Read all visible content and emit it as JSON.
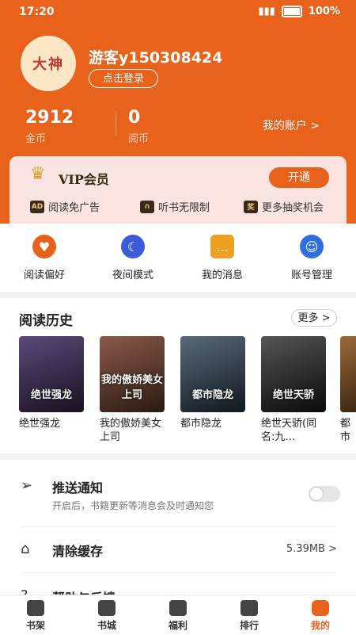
{
  "status": {
    "time": "17:20",
    "battery": "100%"
  },
  "profile": {
    "avatar_text": "大神",
    "username": "游客y150308424",
    "login_label": "点击登录"
  },
  "stats": {
    "coins_value": "2912",
    "coins_label": "金币",
    "read_coins_value": "0",
    "read_coins_label": "阅币",
    "account_link": "我的账户 >"
  },
  "vip": {
    "title": "VIP会员",
    "open_label": "开通",
    "features": [
      {
        "icon": "AD",
        "label": "阅读免广告"
      },
      {
        "icon": "headphones-icon",
        "label": "听书无限制"
      },
      {
        "icon": "奖",
        "label": "更多抽奖机会"
      }
    ]
  },
  "quick_actions": [
    {
      "label": "阅读偏好",
      "icon": "heart-icon",
      "color": "#e8621c"
    },
    {
      "label": "夜间模式",
      "icon": "moon-icon",
      "color": "#3b5bdb"
    },
    {
      "label": "我的消息",
      "icon": "message-icon",
      "color": "#f0a020"
    },
    {
      "label": "账号管理",
      "icon": "user-icon",
      "color": "#2f6fe0"
    }
  ],
  "history": {
    "title": "阅读历史",
    "more_label": "更多 >",
    "books": [
      {
        "title": "绝世强龙",
        "cover_text": "绝世强龙",
        "color": "#3a2a4a"
      },
      {
        "title": "我的傲娇美女上司",
        "cover_text": "我的傲娇美女上司",
        "color": "#5a3a2a"
      },
      {
        "title": "都市隐龙",
        "cover_text": "都市隐龙",
        "color": "#2a3a4a"
      },
      {
        "title": "绝世天骄(同名:九…",
        "cover_text": "绝世天骄",
        "color": "#2a2a2a"
      },
      {
        "title": "都市医",
        "cover_text": "遗",
        "color": "#4a3020"
      }
    ]
  },
  "settings": {
    "push_label": "推送通知",
    "push_desc": "开启后，书籍更新等消息会及时通知您",
    "cache_label": "清除缓存",
    "cache_value": "5.39MB >",
    "help_label": "帮助与反馈"
  },
  "nav": [
    {
      "label": "书架"
    },
    {
      "label": "书城"
    },
    {
      "label": "福利"
    },
    {
      "label": "排行"
    },
    {
      "label": "我的",
      "active": true
    }
  ]
}
